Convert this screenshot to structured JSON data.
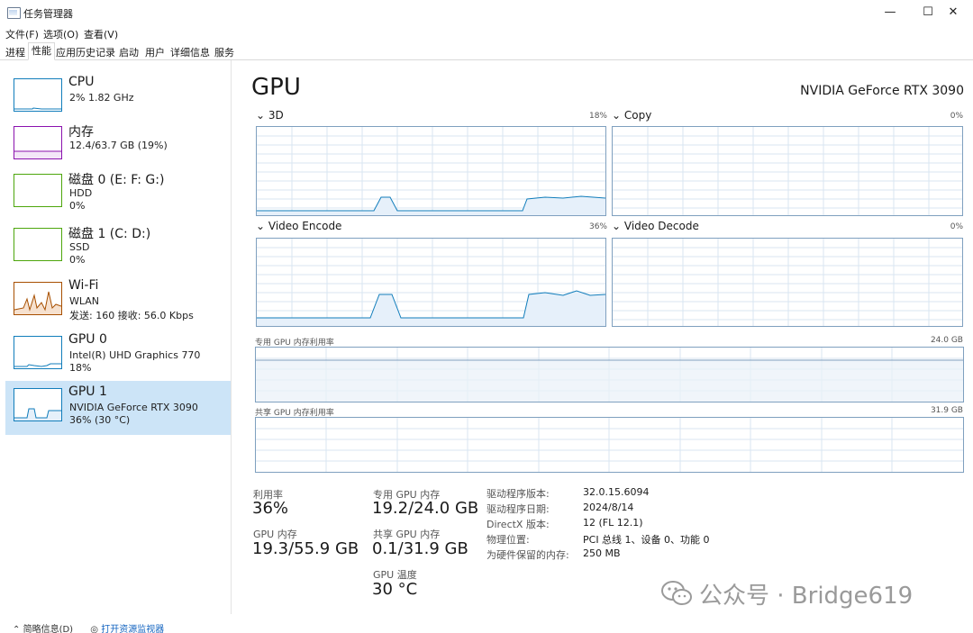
{
  "window": {
    "title": "任务管理器",
    "minimize_glyph": "—",
    "maximize_glyph": "☐",
    "close_glyph": "✕"
  },
  "menu": [
    "文件(F)",
    "选项(O)",
    "查看(V)"
  ],
  "tabs": [
    "进程",
    "性能",
    "应用历史记录",
    "启动",
    "用户",
    "详细信息",
    "服务"
  ],
  "active_tab": "性能",
  "sidebar": {
    "items": [
      {
        "name": "CPU",
        "line2": "2%  1.82 GHz",
        "line3": "",
        "color": "#117dbb"
      },
      {
        "name": "内存",
        "line2": "12.4/63.7 GB (19%)",
        "line3": "",
        "color": "#8b12ae"
      },
      {
        "name": "磁盘 0 (E: F: G:)",
        "line2": "HDD",
        "line3": "0%",
        "color": "#4da60c"
      },
      {
        "name": "磁盘 1 (C: D:)",
        "line2": "SSD",
        "line3": "0%",
        "color": "#4da60c"
      },
      {
        "name": "Wi-Fi",
        "line2": "WLAN",
        "line3": "发送: 160  接收: 56.0 Kbps",
        "color": "#a74f01"
      },
      {
        "name": "GPU 0",
        "line2": "Intel(R) UHD Graphics 770",
        "line3": "18%",
        "color": "#117dbb"
      },
      {
        "name": "GPU 1",
        "line2": "NVIDIA GeForce RTX 3090",
        "line3": "36% (30 °C)",
        "color": "#117dbb"
      }
    ]
  },
  "main": {
    "title": "GPU",
    "model": "NVIDIA GeForce RTX 3090",
    "engines": [
      {
        "label": "3D",
        "percent": "18%"
      },
      {
        "label": "Copy",
        "percent": "0%"
      },
      {
        "label": "Video Encode",
        "percent": "36%"
      },
      {
        "label": "Video Decode",
        "percent": "0%"
      }
    ],
    "dedicated_mem_label": "专用 GPU 内存利用率",
    "dedicated_mem_max": "24.0 GB",
    "shared_mem_label": "共享 GPU 内存利用率",
    "shared_mem_max": "31.9 GB"
  },
  "stats": {
    "utilization_label": "利用率",
    "utilization_value": "36%",
    "gpu_mem_label": "GPU 内存",
    "gpu_mem_value": "19.3/55.9 GB",
    "dedicated_label": "专用 GPU 内存",
    "dedicated_value": "19.2/24.0 GB",
    "shared_label": "共享 GPU 内存",
    "shared_value": "0.1/31.9 GB",
    "temp_label": "GPU 温度",
    "temp_value": "30 °C"
  },
  "info": [
    {
      "key": "驱动程序版本:",
      "value": "32.0.15.6094"
    },
    {
      "key": "驱动程序日期:",
      "value": "2024/8/14"
    },
    {
      "key": "DirectX 版本:",
      "value": "12 (FL 12.1)"
    },
    {
      "key": "物理位置:",
      "value": "PCI 总线 1、设备 0、功能 0"
    },
    {
      "key": "为硬件保留的内存:",
      "value": "250 MB"
    }
  ],
  "footer": {
    "left": "简略信息(D)",
    "link": "打开资源监视器"
  },
  "watermark": {
    "text": "公众号 · Bridge619"
  }
}
